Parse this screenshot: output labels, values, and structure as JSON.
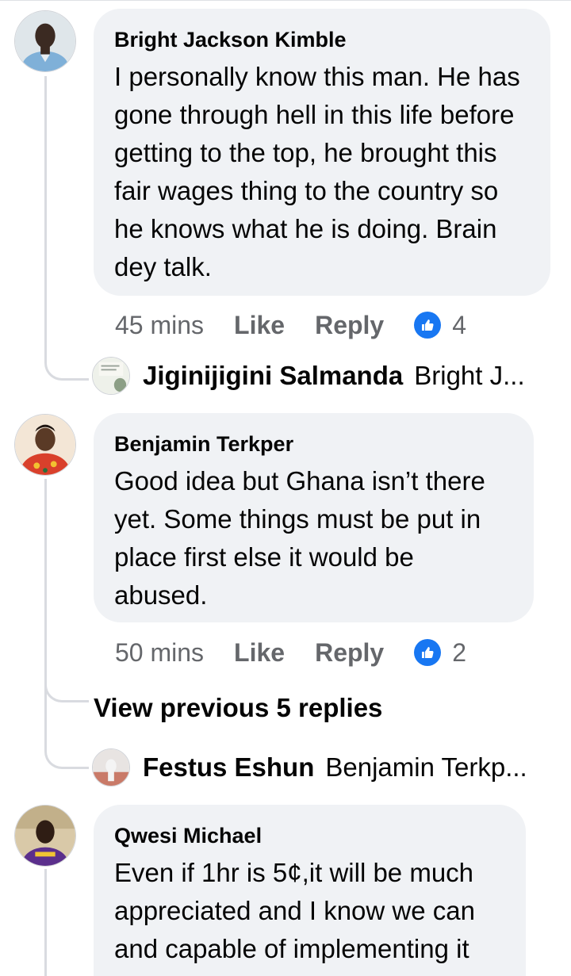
{
  "comments": [
    {
      "author": "Bright Jackson Kimble",
      "text": "I personally know this man. He has gone through hell in this life before getting to the top, he brought this fair wages thing to the country so he knows what he is doing. Brain dey talk.",
      "time": "45 mins",
      "like_label": "Like",
      "reply_label": "Reply",
      "like_count": "4",
      "reply": {
        "author": "Jiginijigini Salmanda",
        "preview": "Bright J..."
      }
    },
    {
      "author": "Benjamin Terkper",
      "text": "Good idea but Ghana isn’t there yet. Some things must be put in place first else it would be abused.",
      "time": "50 mins",
      "like_label": "Like",
      "reply_label": "Reply",
      "like_count": "2",
      "view_previous": "View previous 5 replies",
      "reply": {
        "author": "Festus Eshun",
        "preview": "Benjamin Terkp..."
      }
    },
    {
      "author": "Qwesi Michael",
      "text": "Even if 1hr is 5¢,it will be much appreciated and I know we can and capable of implementing it"
    }
  ],
  "icons": {
    "like_badge": "thumbs-up-icon"
  },
  "colors": {
    "bubble": "#f0f2f5",
    "meta_text": "#65676b",
    "like_blue": "#1877f2",
    "thread_line": "#d9dbe0"
  }
}
